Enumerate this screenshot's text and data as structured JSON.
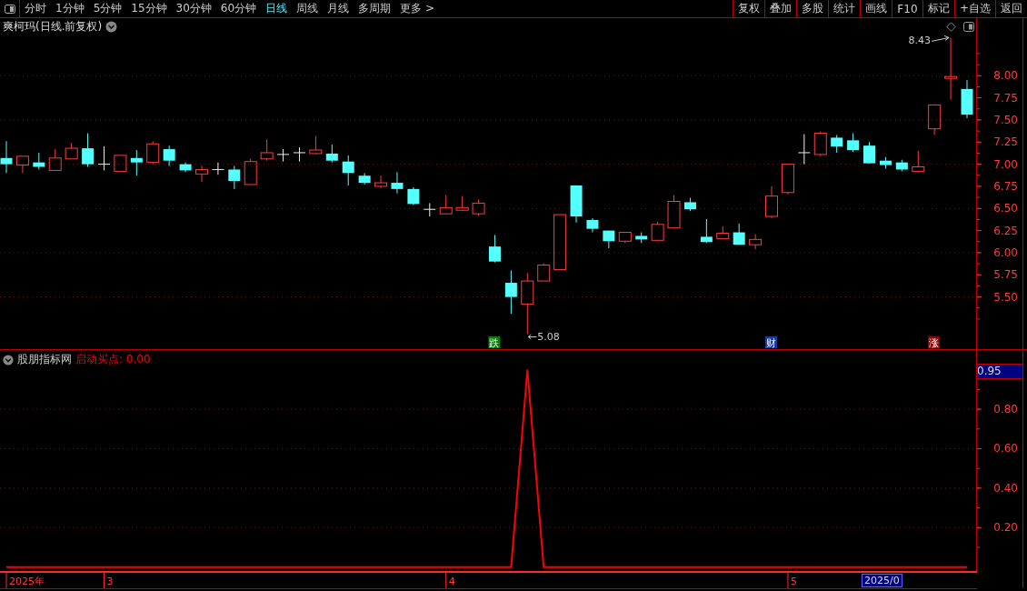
{
  "toolbar": {
    "periods": [
      {
        "label": "分时",
        "selected": false
      },
      {
        "label": "1分钟",
        "selected": false
      },
      {
        "label": "5分钟",
        "selected": false
      },
      {
        "label": "15分钟",
        "selected": false
      },
      {
        "label": "30分钟",
        "selected": false
      },
      {
        "label": "60分钟",
        "selected": false
      },
      {
        "label": "日线",
        "selected": true
      },
      {
        "label": "周线",
        "selected": false
      },
      {
        "label": "月线",
        "selected": false
      },
      {
        "label": "多周期",
        "selected": false
      },
      {
        "label": "更多 >",
        "selected": false
      }
    ],
    "buttons": [
      "复权",
      "叠加",
      "多股",
      "统计",
      "画线",
      "F10",
      "标记",
      "+自选",
      "返回"
    ]
  },
  "price_panel": {
    "title": "爽柯玛(日线.前复权)",
    "chart_data": {
      "type": "candlestick",
      "ohlc": [
        [
          7.07,
          7.26,
          6.9,
          7.0
        ],
        [
          6.99,
          7.09,
          6.9,
          7.09
        ],
        [
          7.02,
          7.13,
          6.94,
          6.97
        ],
        [
          6.93,
          7.17,
          6.93,
          7.07
        ],
        [
          7.06,
          7.24,
          7.06,
          7.18
        ],
        [
          7.18,
          7.35,
          6.97,
          7.0
        ],
        [
          7.0,
          7.2,
          6.93,
          7.0
        ],
        [
          6.92,
          7.1,
          6.92,
          7.1
        ],
        [
          7.07,
          7.16,
          6.87,
          7.02
        ],
        [
          7.02,
          7.26,
          7.0,
          7.23
        ],
        [
          7.17,
          7.21,
          6.98,
          7.04
        ],
        [
          7.0,
          7.02,
          6.91,
          6.93
        ],
        [
          6.89,
          6.98,
          6.8,
          6.94
        ],
        [
          6.94,
          7.02,
          6.88,
          6.94
        ],
        [
          6.94,
          6.98,
          6.72,
          6.81
        ],
        [
          6.77,
          7.06,
          6.77,
          7.03
        ],
        [
          7.06,
          7.28,
          7.04,
          7.13
        ],
        [
          7.11,
          7.17,
          7.03,
          7.11
        ],
        [
          7.13,
          7.19,
          7.03,
          7.13
        ],
        [
          7.12,
          7.32,
          7.11,
          7.16
        ],
        [
          7.12,
          7.22,
          7.02,
          7.04
        ],
        [
          7.03,
          7.1,
          6.76,
          6.9
        ],
        [
          6.87,
          6.9,
          6.77,
          6.79
        ],
        [
          6.75,
          6.87,
          6.73,
          6.79
        ],
        [
          6.79,
          6.91,
          6.67,
          6.72
        ],
        [
          6.72,
          6.74,
          6.54,
          6.55
        ],
        [
          6.49,
          6.56,
          6.41,
          6.49
        ],
        [
          6.44,
          6.65,
          6.44,
          6.51
        ],
        [
          6.48,
          6.64,
          6.47,
          6.51
        ],
        [
          6.44,
          6.6,
          6.42,
          6.56
        ],
        [
          6.07,
          6.2,
          5.89,
          5.9
        ],
        [
          5.66,
          5.8,
          5.31,
          5.5
        ],
        [
          5.42,
          5.77,
          5.08,
          5.68
        ],
        [
          5.68,
          5.88,
          5.68,
          5.86
        ],
        [
          5.81,
          6.43,
          5.81,
          6.43
        ],
        [
          6.76,
          6.76,
          6.34,
          6.41
        ],
        [
          6.37,
          6.39,
          6.23,
          6.27
        ],
        [
          6.25,
          6.25,
          6.05,
          6.13
        ],
        [
          6.13,
          6.23,
          6.11,
          6.23
        ],
        [
          6.19,
          6.23,
          6.11,
          6.15
        ],
        [
          6.14,
          6.35,
          6.14,
          6.32
        ],
        [
          6.28,
          6.65,
          6.28,
          6.58
        ],
        [
          6.57,
          6.62,
          6.47,
          6.49
        ],
        [
          6.18,
          6.38,
          6.11,
          6.12
        ],
        [
          6.16,
          6.3,
          6.16,
          6.22
        ],
        [
          6.23,
          6.33,
          6.09,
          6.09
        ],
        [
          6.09,
          6.21,
          6.04,
          6.15
        ],
        [
          6.41,
          6.75,
          6.39,
          6.64
        ],
        [
          6.68,
          7.0,
          6.66,
          7.0
        ],
        [
          7.13,
          7.34,
          7.0,
          7.13
        ],
        [
          7.11,
          7.37,
          7.09,
          7.35
        ],
        [
          7.3,
          7.33,
          7.13,
          7.2
        ],
        [
          7.27,
          7.35,
          7.14,
          7.16
        ],
        [
          7.21,
          7.25,
          7.01,
          7.01
        ],
        [
          7.04,
          7.08,
          6.95,
          6.99
        ],
        [
          7.02,
          7.05,
          6.92,
          6.94
        ],
        [
          6.92,
          7.15,
          6.92,
          6.97
        ],
        [
          7.4,
          7.67,
          7.33,
          7.67
        ],
        [
          7.97,
          8.43,
          7.73,
          7.99
        ],
        [
          7.85,
          7.95,
          7.52,
          7.56
        ]
      ],
      "yticks": [
        {
          "value": 8,
          "label": "8.00"
        },
        {
          "value": 7.75,
          "label": "7.75"
        },
        {
          "value": 7.5,
          "label": "7.50"
        },
        {
          "value": 7.25,
          "label": "7.25"
        },
        {
          "value": 7,
          "label": "7.00"
        },
        {
          "value": 6.75,
          "label": "6.75"
        },
        {
          "value": 6.5,
          "label": "6.50"
        },
        {
          "value": 6.25,
          "label": "6.25"
        },
        {
          "value": 6,
          "label": "6.00"
        },
        {
          "value": 5.75,
          "label": "5.75"
        },
        {
          "value": 5.5,
          "label": "5.50"
        }
      ],
      "ylim": [
        4.9,
        8.65
      ],
      "grid": true
    },
    "high_label": "8.43",
    "low_label": "5.08",
    "signals": [
      {
        "text": "跌",
        "color": "#0a7a0a"
      },
      {
        "text": "财",
        "color": "#1a3aa0"
      },
      {
        "text": "涨",
        "color": "#8a0a0a"
      }
    ]
  },
  "indicator_panel": {
    "name": "股朋指标网",
    "line_value": ": 0.00",
    "top_value": "0.95",
    "chart_data": {
      "type": "line",
      "series": [
        {
          "name": "启动买点",
          "color": "#ff0000",
          "values": [
            0,
            0,
            0,
            0,
            0,
            0,
            0,
            0,
            0,
            0,
            0,
            0,
            0,
            0,
            0,
            0,
            0,
            0,
            0,
            0,
            0,
            0,
            0,
            0,
            0,
            0,
            0,
            0,
            0,
            0,
            0,
            0,
            1,
            0,
            0,
            0,
            0,
            0,
            0,
            0,
            0,
            0,
            0,
            0,
            0,
            0,
            0,
            0,
            0,
            0,
            0,
            0,
            0,
            0,
            0,
            0,
            0,
            0,
            0,
            0
          ]
        }
      ],
      "yticks": [
        {
          "value": 0.8,
          "label": "0.80"
        },
        {
          "value": 0.6,
          "label": "0.60"
        },
        {
          "value": 0.4,
          "label": "0.40"
        },
        {
          "value": 0.2,
          "label": "0.20"
        }
      ],
      "ylim": [
        -0.02,
        1.1
      ],
      "grid": true
    }
  },
  "time_axis": {
    "labels": [
      "2025年",
      "3",
      "4",
      "5"
    ],
    "cursor_date": "2025/0"
  }
}
